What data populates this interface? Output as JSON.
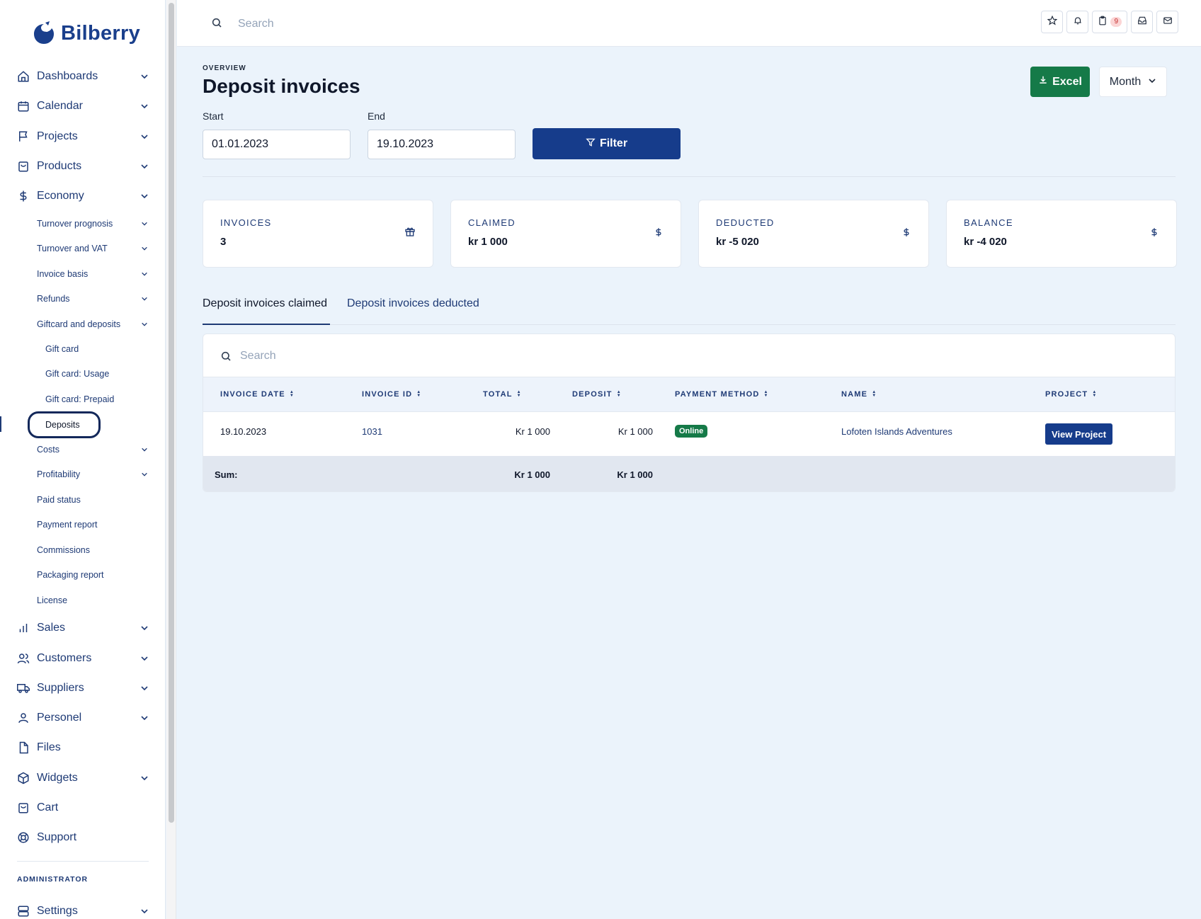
{
  "brand": {
    "name": "Bilberry"
  },
  "sidebar": {
    "main_items": [
      {
        "label": "Dashboards",
        "icon": "home-icon"
      },
      {
        "label": "Calendar",
        "icon": "calendar-icon"
      },
      {
        "label": "Projects",
        "icon": "flag-icon"
      },
      {
        "label": "Products",
        "icon": "bag-icon"
      },
      {
        "label": "Economy",
        "icon": "dollar-icon"
      }
    ],
    "economy_sub": [
      {
        "label": "Turnover prognosis"
      },
      {
        "label": "Turnover and VAT"
      },
      {
        "label": "Invoice basis"
      },
      {
        "label": "Refunds"
      },
      {
        "label": "Giftcard and deposits"
      }
    ],
    "giftcard_sub": [
      {
        "label": "Gift card"
      },
      {
        "label": "Gift card: Usage"
      },
      {
        "label": "Gift card: Prepaid"
      },
      {
        "label": "Deposits"
      }
    ],
    "economy_sub2": [
      {
        "label": "Costs"
      },
      {
        "label": "Profitability"
      },
      {
        "label": "Paid status"
      },
      {
        "label": "Payment report"
      },
      {
        "label": "Commissions"
      },
      {
        "label": "Packaging report"
      },
      {
        "label": "License"
      }
    ],
    "lower_items": [
      {
        "label": "Sales",
        "icon": "bar-chart-icon"
      },
      {
        "label": "Customers",
        "icon": "users-icon"
      },
      {
        "label": "Suppliers",
        "icon": "truck-icon"
      },
      {
        "label": "Personel",
        "icon": "user-icon"
      },
      {
        "label": "Files",
        "icon": "file-icon"
      },
      {
        "label": "Widgets",
        "icon": "cube-icon"
      },
      {
        "label": "Cart",
        "icon": "cart-icon"
      },
      {
        "label": "Support",
        "icon": "lifebuoy-icon"
      }
    ],
    "admin_label": "ADMINISTRATOR",
    "settings": {
      "label": "Settings",
      "icon": "server-icon"
    }
  },
  "topbar": {
    "search_placeholder": "Search",
    "notification_count": "9"
  },
  "page": {
    "eyebrow": "OVERVIEW",
    "title": "Deposit invoices",
    "excel_label": "Excel",
    "period_label": "Month",
    "start_label": "Start",
    "start_value": "01.01.2023",
    "end_label": "End",
    "end_value": "19.10.2023",
    "filter_label": "Filter"
  },
  "stats": [
    {
      "label": "INVOICES",
      "value": "3",
      "icon": "gift-icon"
    },
    {
      "label": "CLAIMED",
      "value": "kr 1 000",
      "icon": "dollar-icon"
    },
    {
      "label": "DEDUCTED",
      "value": "kr -5 020",
      "icon": "dollar-icon"
    },
    {
      "label": "BALANCE",
      "value": "kr -4 020",
      "icon": "dollar-icon"
    }
  ],
  "tabs": [
    {
      "label": "Deposit invoices claimed",
      "active": true
    },
    {
      "label": "Deposit invoices deducted",
      "active": false
    }
  ],
  "table": {
    "search_placeholder": "Search",
    "columns": [
      "INVOICE DATE",
      "INVOICE ID",
      "TOTAL",
      "DEPOSIT",
      "PAYMENT METHOD",
      "NAME",
      "PROJECT"
    ],
    "rows": [
      {
        "invoice_date": "19.10.2023",
        "invoice_id": "1031",
        "total": "Kr 1 000",
        "deposit": "Kr 1 000",
        "payment_method": "Online",
        "name": "Lofoten Islands Adventures",
        "project_action": "View Project"
      }
    ],
    "footer": {
      "label": "Sum:",
      "total": "Kr 1 000",
      "deposit": "Kr 1 000"
    }
  },
  "colors": {
    "primary": "#163c8b",
    "success": "#157a48",
    "background": "#ebf3fb",
    "nav_text": "#1e3a75"
  }
}
